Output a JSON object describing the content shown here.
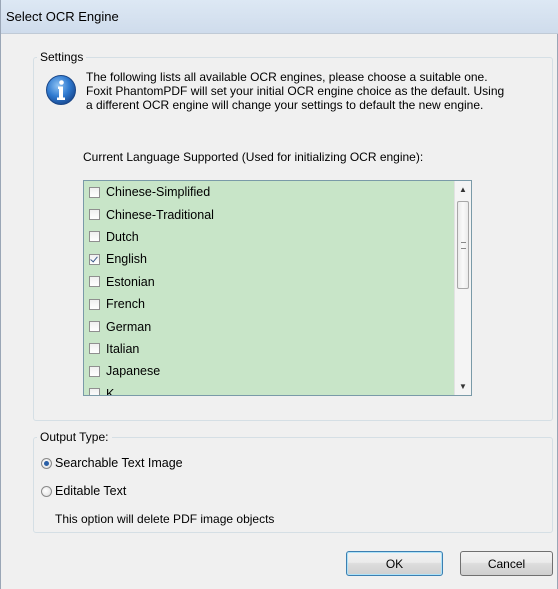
{
  "window": {
    "title": "Select OCR Engine"
  },
  "settings": {
    "legend": "Settings",
    "icon": "info-icon",
    "description_lines": [
      "The following lists all available OCR engines, please choose a suitable one.",
      "Foxit PhantomPDF will set your initial OCR engine choice as the default. Using",
      "a different OCR engine will change your settings to default the new engine."
    ],
    "language_caption": "Current Language Supported (Used for initializing OCR engine):",
    "languages": [
      {
        "label": "Chinese-Simplified",
        "checked": false
      },
      {
        "label": "Chinese-Traditional",
        "checked": false
      },
      {
        "label": "Dutch",
        "checked": false
      },
      {
        "label": "English",
        "checked": true
      },
      {
        "label": "Estonian",
        "checked": false
      },
      {
        "label": "French",
        "checked": false
      },
      {
        "label": "German",
        "checked": false
      },
      {
        "label": "Italian",
        "checked": false
      },
      {
        "label": "Japanese",
        "checked": false
      },
      {
        "label": "K",
        "checked": false
      }
    ],
    "listbox_color": "#c8e5c8"
  },
  "output": {
    "legend": "Output Type:",
    "options": [
      {
        "label": "Searchable Text Image",
        "selected": true
      },
      {
        "label": "Editable Text",
        "selected": false
      }
    ],
    "note": "This option will delete PDF image objects"
  },
  "buttons": {
    "ok": "OK",
    "cancel": "Cancel"
  }
}
